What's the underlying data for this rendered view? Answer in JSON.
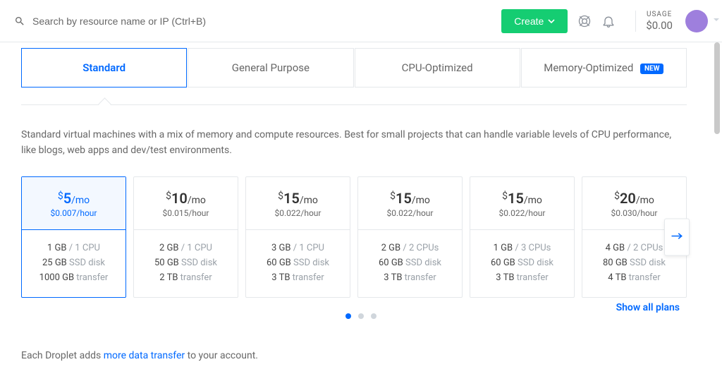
{
  "topbar": {
    "search_placeholder": "Search by resource name or IP (Ctrl+B)",
    "create_label": "Create",
    "usage_label": "USAGE",
    "usage_amount": "$0.00"
  },
  "tabs": {
    "standard": "Standard",
    "general": "General Purpose",
    "cpu": "CPU-Optimized",
    "memory": "Memory-Optimized",
    "new_badge": "NEW"
  },
  "description": "Standard virtual machines with a mix of memory and compute resources. Best for small projects that can handle variable levels of CPU performance, like blogs, web apps and dev/test environments.",
  "plans": [
    {
      "price_amt": "5",
      "price_per": "/mo",
      "hourly": "$0.007/hour",
      "ram": "1 GB",
      "cpu": "1 CPU",
      "disk_v": "25 GB",
      "disk_l": "SSD disk",
      "transfer_v": "1000 GB",
      "transfer_l": "transfer"
    },
    {
      "price_amt": "10",
      "price_per": "/mo",
      "hourly": "$0.015/hour",
      "ram": "2 GB",
      "cpu": "1 CPU",
      "disk_v": "50 GB",
      "disk_l": "SSD disk",
      "transfer_v": "2 TB",
      "transfer_l": "transfer"
    },
    {
      "price_amt": "15",
      "price_per": "/mo",
      "hourly": "$0.022/hour",
      "ram": "3 GB",
      "cpu": "1 CPU",
      "disk_v": "60 GB",
      "disk_l": "SSD disk",
      "transfer_v": "3 TB",
      "transfer_l": "transfer"
    },
    {
      "price_amt": "15",
      "price_per": "/mo",
      "hourly": "$0.022/hour",
      "ram": "2 GB",
      "cpu": "2 CPUs",
      "disk_v": "60 GB",
      "disk_l": "SSD disk",
      "transfer_v": "3 TB",
      "transfer_l": "transfer"
    },
    {
      "price_amt": "15",
      "price_per": "/mo",
      "hourly": "$0.022/hour",
      "ram": "1 GB",
      "cpu": "3 CPUs",
      "disk_v": "60 GB",
      "disk_l": "SSD disk",
      "transfer_v": "3 TB",
      "transfer_l": "transfer"
    },
    {
      "price_amt": "20",
      "price_per": "/mo",
      "hourly": "$0.030/hour",
      "ram": "4 GB",
      "cpu": "2 CPUs",
      "disk_v": "80 GB",
      "disk_l": "SSD disk",
      "transfer_v": "4 TB",
      "transfer_l": "transfer"
    }
  ],
  "show_all_label": "Show all plans",
  "footnote": {
    "a": "Each Droplet adds ",
    "link": "more data transfer",
    "b": " to your account."
  }
}
